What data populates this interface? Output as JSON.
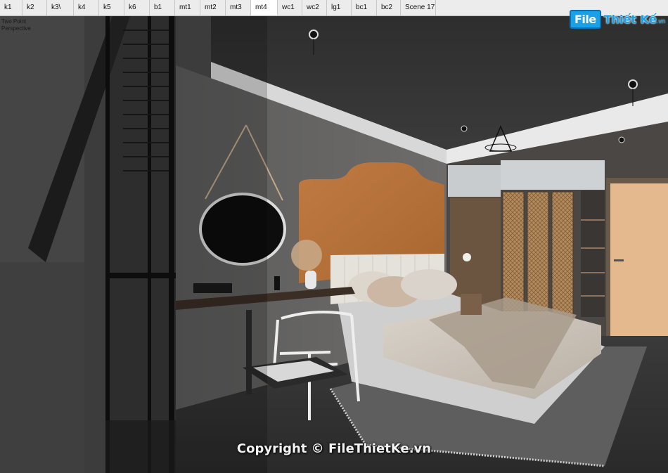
{
  "tabs": [
    {
      "label": "k1"
    },
    {
      "label": "k2"
    },
    {
      "label": "k3\\"
    },
    {
      "label": "k4"
    },
    {
      "label": "k5"
    },
    {
      "label": "k6"
    },
    {
      "label": "b1"
    },
    {
      "label": "mt1"
    },
    {
      "label": "mt2"
    },
    {
      "label": "mt3"
    },
    {
      "label": "mt4"
    },
    {
      "label": "wc1"
    },
    {
      "label": "wc2"
    },
    {
      "label": "lg1"
    },
    {
      "label": "bc1"
    },
    {
      "label": "bc2"
    },
    {
      "label": "Scene 17"
    }
  ],
  "active_tab": "mt4",
  "view_label": {
    "line1": "Two Point",
    "line2": "Perspective"
  },
  "logo": {
    "mark": "File",
    "text": "Thiết Kế",
    "tld": ".vn"
  },
  "watermark": "Copyright © FileThietKe.vn",
  "colors": {
    "accent": "#1aa0e6",
    "headboard": "#b8743f",
    "toolbar": "#ececec"
  }
}
